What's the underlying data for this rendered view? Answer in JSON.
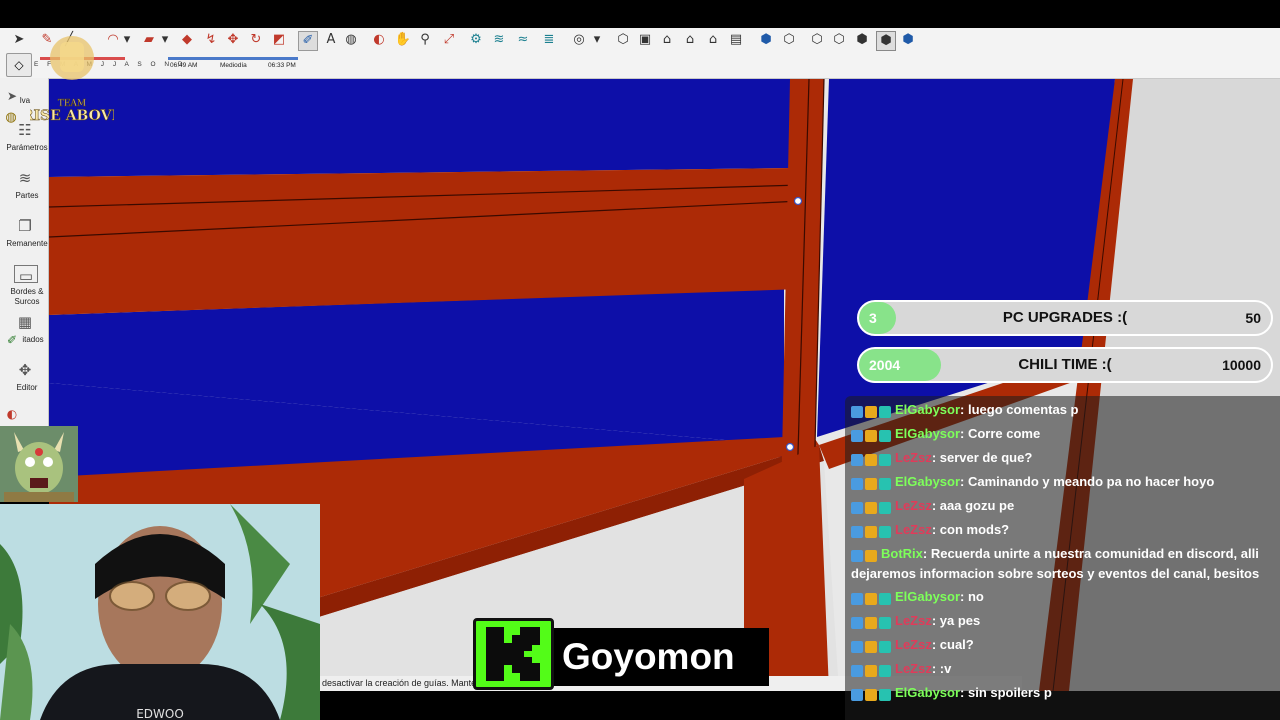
{
  "toolbar": {
    "timeline": {
      "months": "E F M A M J J A S O N D",
      "sunrise": "06:49 AM",
      "midday": "Mediodía",
      "sunset": "06:33 PM"
    }
  },
  "left_panel": {
    "items": [
      {
        "label": "Parámetros",
        "icon": "sliders-icon"
      },
      {
        "label": "Partes",
        "icon": "layers-icon"
      },
      {
        "label": "Remanente",
        "icon": "copy-icon"
      },
      {
        "label": "Bordes & Surcos",
        "icon": "frame-icon"
      },
      {
        "label": "itados",
        "icon": "grid-icon"
      },
      {
        "label": "Editor",
        "icon": "move-icon"
      }
    ],
    "partial_top_label": "lva"
  },
  "logo": {
    "line1": "TEAM",
    "line2": "RISE ABOVE"
  },
  "status_bar": {
    "text": "desactivar la creación de guías. Manten"
  },
  "streamer": {
    "name": "Goyomon"
  },
  "goals": [
    {
      "current": "3",
      "title": "PC UPGRADES :(",
      "target": "50",
      "progress": 0.06
    },
    {
      "current": "2004",
      "title": "CHILI TIME :(",
      "target": "10000",
      "progress": 0.2
    }
  ],
  "chat": [
    {
      "user": "ElGabysor",
      "color": "#7dff5a",
      "badges": 3,
      "message": ": luego comentas p"
    },
    {
      "user": "ElGabysor",
      "color": "#7dff5a",
      "badges": 3,
      "message": ": Corre come"
    },
    {
      "user": "LeZsz",
      "color": "#e03b5a",
      "badges": 3,
      "message": ": server de que?"
    },
    {
      "user": "ElGabysor",
      "color": "#7dff5a",
      "badges": 3,
      "message": ": Caminando y meando pa no hacer hoyo"
    },
    {
      "user": "LeZsz",
      "color": "#e03b5a",
      "badges": 3,
      "message": ": aaa gozu pe"
    },
    {
      "user": "LeZsz",
      "color": "#e03b5a",
      "badges": 3,
      "message": ": con mods?"
    },
    {
      "user": "BotRix",
      "color": "#7dff5a",
      "badges": 2,
      "message": ": Recuerda unirte a nuestra comunidad en discord, alli dejaremos informacion sobre sorteos y eventos del canal, besitos"
    },
    {
      "user": "ElGabysor",
      "color": "#7dff5a",
      "badges": 3,
      "message": ": no"
    },
    {
      "user": "LeZsz",
      "color": "#e03b5a",
      "badges": 3,
      "message": ": ya pes"
    },
    {
      "user": "LeZsz",
      "color": "#e03b5a",
      "badges": 3,
      "message": ": cual?"
    },
    {
      "user": "LeZsz",
      "color": "#e03b5a",
      "badges": 3,
      "message": ": :v"
    },
    {
      "user": "ElGabysor",
      "color": "#7dff5a",
      "badges": 3,
      "message": ": sin spoilers p"
    }
  ],
  "colors": {
    "panel_red": "#b02a08",
    "panel_blue": "#0a0aa4",
    "kick_green": "#53fc18"
  }
}
